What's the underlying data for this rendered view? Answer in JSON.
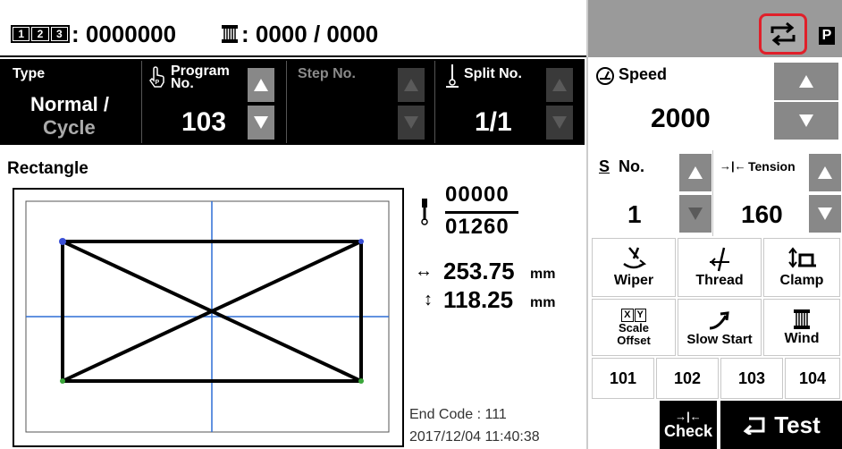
{
  "header": {
    "counter_icon": "counter-digits-icon",
    "counter_value": ": 0000000",
    "bobbin_icon": "bobbin-counter-icon",
    "bobbin_value": ": 0000 / 0000",
    "mode_icon": "cycle-switch-icon",
    "p_badge": "P"
  },
  "type_box": {
    "label": "Type",
    "value_line1": "Normal /",
    "value_line2": "Cycle"
  },
  "program": {
    "label_line1": "Program",
    "label_line2": "No.",
    "value": "103",
    "icon": "hand-pointer-icon"
  },
  "step": {
    "label": "Step No.",
    "value": ""
  },
  "split": {
    "label": "Split No.",
    "value": "1/1",
    "icon": "needle-icon"
  },
  "speed": {
    "label": "Speed",
    "value": "2000",
    "icon": "speed-gauge-icon"
  },
  "pattern": {
    "name": "Rectangle",
    "stitch_current": "00000",
    "stitch_total": "01260",
    "width": "253.75",
    "height": "118.25",
    "unit": "mm"
  },
  "s_no": {
    "label": "No.",
    "prefix": "S",
    "value": "1"
  },
  "tension": {
    "label": "Tension",
    "value": "160"
  },
  "functions": {
    "wiper": "Wiper",
    "thread": "Thread",
    "clamp": "Clamp",
    "scale_line1": "Scale",
    "scale_line2": "Offset",
    "scale_icon_text": "XY",
    "slow_start": "Slow Start",
    "wind": "Wind"
  },
  "presets": [
    "101",
    "102",
    "103",
    "104"
  ],
  "footer": {
    "end_code": "End Code : 111",
    "datetime": "2017/12/04 11:40:38",
    "check_label": "Check",
    "test_label": "Test"
  },
  "colors": {
    "highlight": "#e0202a",
    "guide_line": "#2f6fd6"
  }
}
